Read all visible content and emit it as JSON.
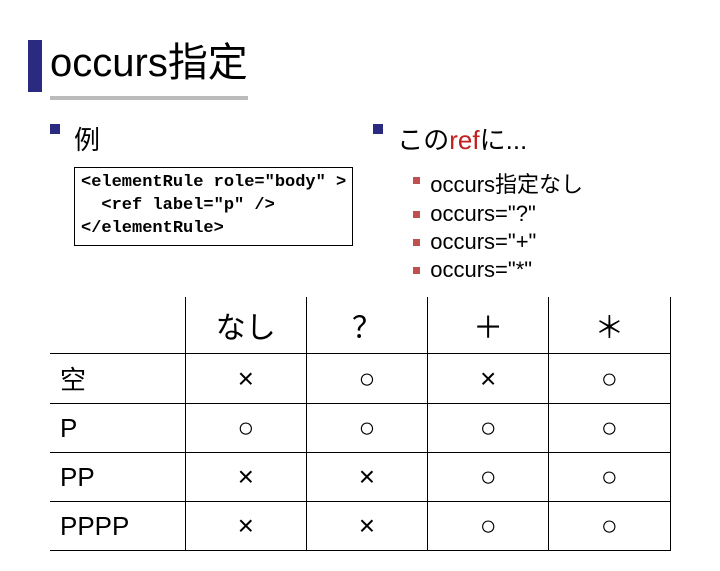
{
  "title": "occurs指定",
  "left_bullet": "例",
  "code_lines": [
    "<elementRule role=\"body\" >",
    "  <ref label=\"p\" />",
    "</elementRule>"
  ],
  "right_bullet_prefix": "この",
  "right_bullet_ref": "ref",
  "right_bullet_suffix": "に...",
  "sub_items": [
    "occurs指定なし",
    "occurs=\"?\"",
    "occurs=\"+\"",
    "occurs=\"*\""
  ],
  "table": {
    "col_headers": [
      "なし",
      "？",
      "＋",
      "＊"
    ],
    "rows": [
      {
        "label": "空",
        "cells": [
          "×",
          "○",
          "×",
          "○"
        ]
      },
      {
        "label": "P",
        "cells": [
          "○",
          "○",
          "○",
          "○"
        ]
      },
      {
        "label": "PP",
        "cells": [
          "×",
          "×",
          "○",
          "○"
        ]
      },
      {
        "label": "PPPP",
        "cells": [
          "×",
          "×",
          "○",
          "○"
        ]
      }
    ]
  }
}
